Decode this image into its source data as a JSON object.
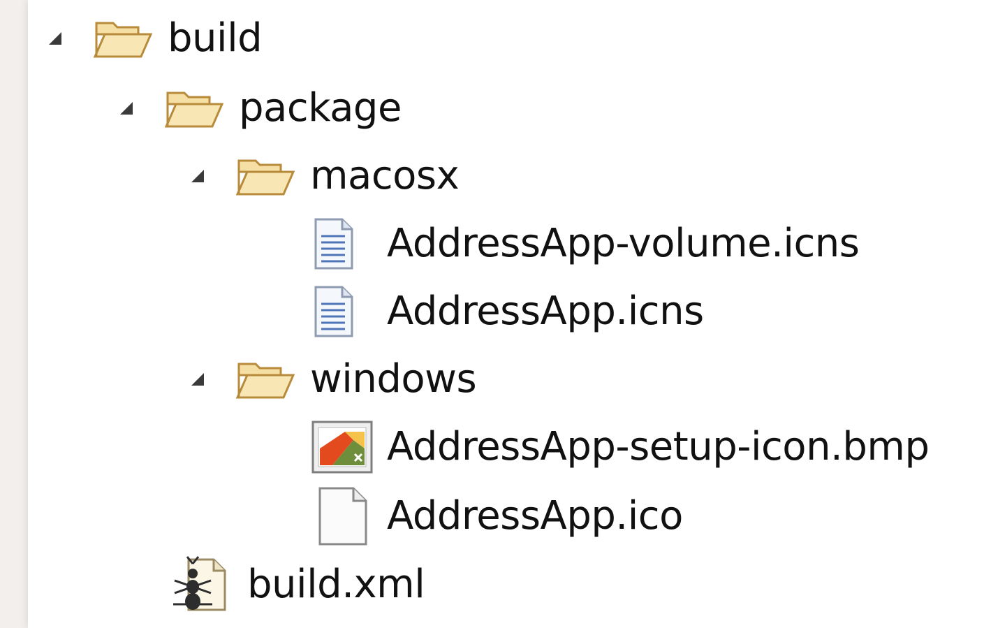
{
  "tree": {
    "items": [
      {
        "id": "build",
        "label": "build",
        "type": "folder",
        "expanded": true,
        "depth": 0
      },
      {
        "id": "package",
        "label": "package",
        "type": "folder",
        "expanded": true,
        "depth": 1
      },
      {
        "id": "macosx",
        "label": "macosx",
        "type": "folder",
        "expanded": true,
        "depth": 2
      },
      {
        "id": "volume-icns",
        "label": "AddressApp-volume.icns",
        "type": "text-file",
        "depth": 3
      },
      {
        "id": "app-icns",
        "label": "AddressApp.icns",
        "type": "text-file",
        "depth": 3
      },
      {
        "id": "windows",
        "label": "windows",
        "type": "folder",
        "expanded": true,
        "depth": 2
      },
      {
        "id": "setup-bmp",
        "label": "AddressApp-setup-icon.bmp",
        "type": "image-file",
        "depth": 3
      },
      {
        "id": "app-ico",
        "label": "AddressApp.ico",
        "type": "blank-file",
        "depth": 3
      },
      {
        "id": "build-xml",
        "label": "build.xml",
        "type": "ant-file",
        "depth": 1
      }
    ]
  },
  "colors": {
    "folder_fill": "#f6dfa5",
    "folder_stroke": "#b88b3b",
    "twisty": "#3a3a3a",
    "text": "#111111"
  }
}
